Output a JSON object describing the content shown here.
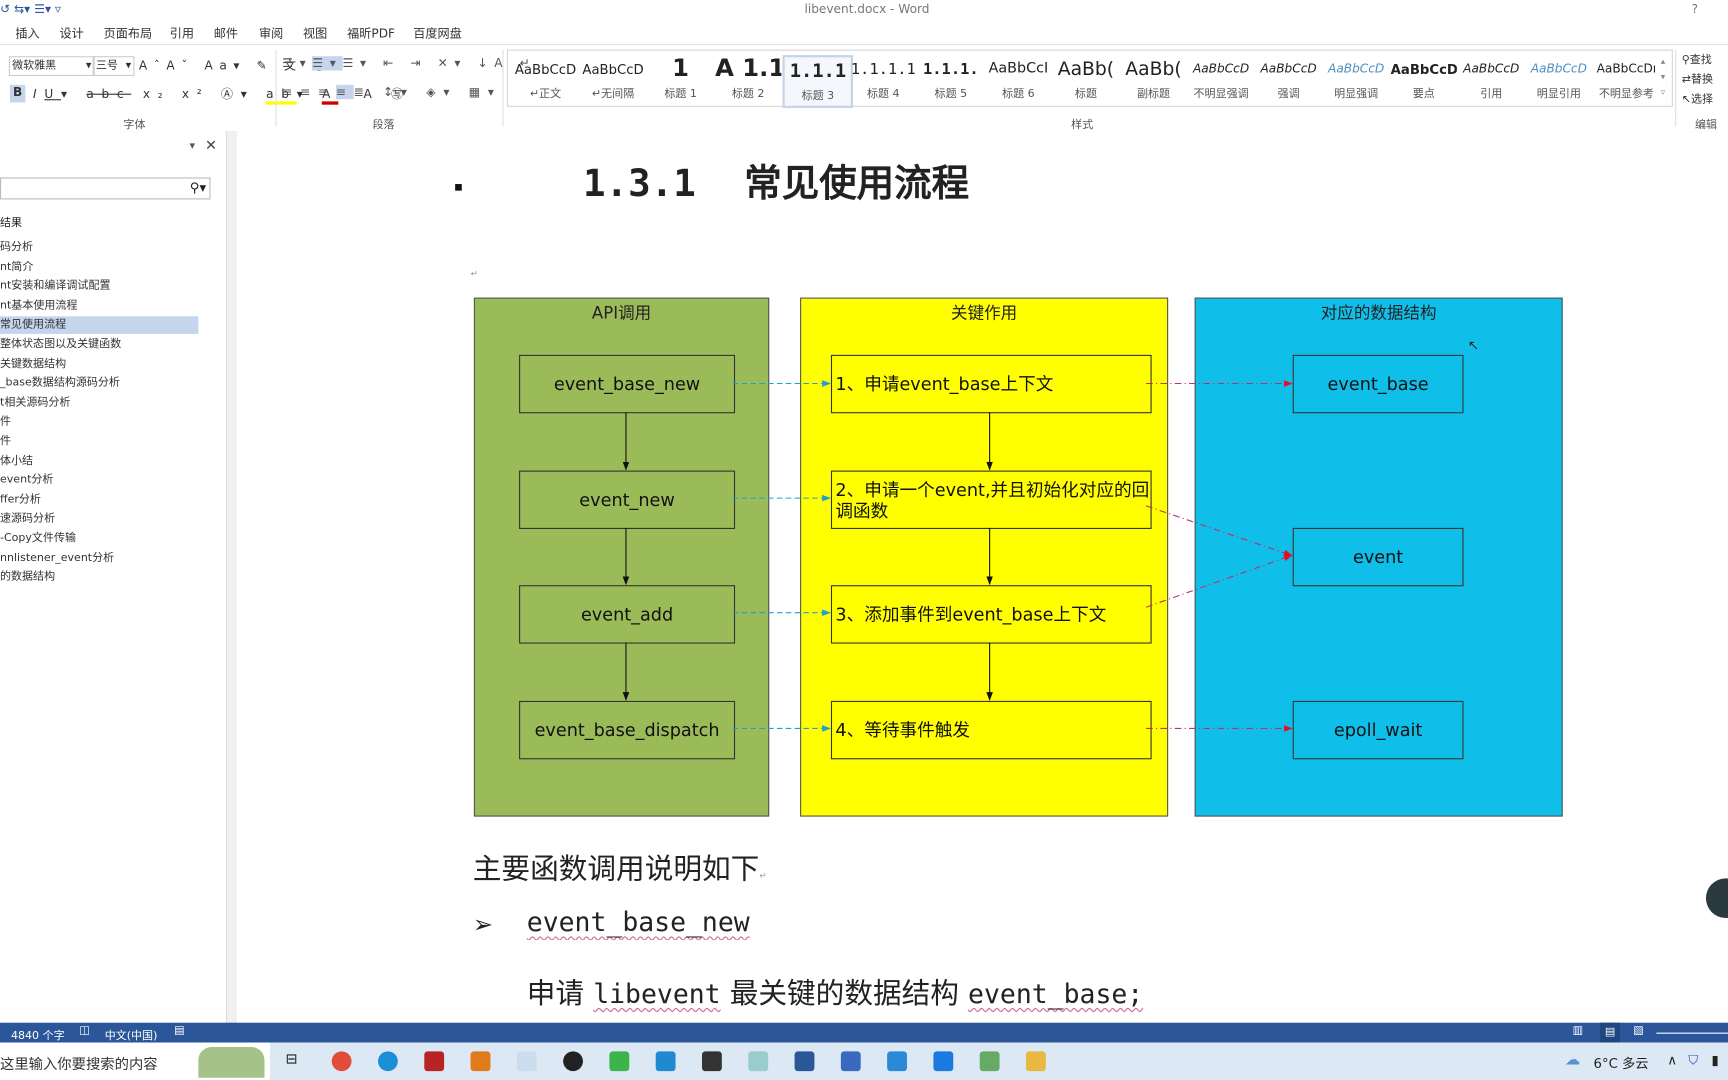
{
  "window": {
    "title": "libevent.docx - Word",
    "help": "?"
  },
  "tabs": [
    "插入",
    "设计",
    "页面布局",
    "引用",
    "邮件",
    "审阅",
    "视图",
    "福昕PDF",
    "百度网盘"
  ],
  "ribbon": {
    "font": {
      "name": "微软雅黑",
      "size": "三号",
      "group_label": "字体"
    },
    "paragraph": {
      "group_label": "段落"
    },
    "styles": {
      "group_label": "样式",
      "items": [
        {
          "preview": "AaBbCcD",
          "label": "↵正文"
        },
        {
          "preview": "AaBbCcD",
          "label": "↵无间隔"
        },
        {
          "preview": "1",
          "label": "标题 1"
        },
        {
          "preview": "A 1.1",
          "label": "标题 2"
        },
        {
          "preview": "1.1.1",
          "label": "标题 3",
          "selected": true
        },
        {
          "preview": "1.1.1.1",
          "label": "标题 4"
        },
        {
          "preview": "1.1.1.",
          "label": "标题 5"
        },
        {
          "preview": "AaBbCcI",
          "label": "标题 6"
        },
        {
          "preview": "AaBb(",
          "label": "标题"
        },
        {
          "preview": "AaBb(",
          "label": "副标题"
        },
        {
          "preview": "AaBbCcD",
          "label": "不明显强调"
        },
        {
          "preview": "AaBbCcD",
          "label": "强调"
        },
        {
          "preview": "AaBbCcD",
          "label": "明显强调"
        },
        {
          "preview": "AaBbCcD",
          "label": "要点"
        },
        {
          "preview": "AaBbCcD",
          "label": "引用"
        },
        {
          "preview": "AaBbCcD",
          "label": "明显引用"
        },
        {
          "preview": "AaBbCcDı",
          "label": "不明显参考"
        }
      ]
    },
    "editing": {
      "group_label": "编辑",
      "find": "查找",
      "replace": "替换",
      "select": "选择"
    }
  },
  "nav": {
    "results_label": "结果",
    "items": [
      "码分析",
      "nt简介",
      "nt安装和编译调试配置",
      "nt基本使用流程",
      "常见使用流程",
      "整体状态图以及关键函数",
      "关键数据结构",
      "_base数据结构源码分析",
      "t相关源码分析",
      "件",
      "件",
      "体小结",
      "event分析",
      "ffer分析",
      "速源码分析",
      "-Copy文件传输",
      "nnlistener_event分析",
      "的数据结构"
    ],
    "selected_index": 4
  },
  "document": {
    "heading_number": "1.3.1",
    "heading_text": "常见使用流程",
    "diagram": {
      "columns": [
        {
          "title": "API调用",
          "color": "#9bbb59",
          "boxes": [
            "event_base_new",
            "event_new",
            "event_add",
            "event_base_dispatch"
          ]
        },
        {
          "title": "关键作用",
          "color": "#ffff00",
          "boxes": [
            "1、申请event_base上下文",
            "2、申请一个event,并且初始化对应的回调函数",
            "3、添加事件到event_base上下文",
            "4、等待事件触发"
          ]
        },
        {
          "title": "对应的数据结构",
          "color": "#0fbfea",
          "boxes": [
            "event_base",
            "event",
            "epoll_wait"
          ]
        }
      ]
    },
    "para1": "主要函数调用说明如下",
    "bullet_code": "event_base_new",
    "para2_prefix": "申请",
    "para2_code1": "libevent",
    "para2_mid": "最关键的数据结构",
    "para2_code2": "event_base;"
  },
  "status": {
    "word_count": "4840 个字",
    "language": "中文(中国)"
  },
  "taskbar": {
    "search_placeholder": "这里输入你要搜索的内容",
    "weather": "6°C 多云"
  }
}
